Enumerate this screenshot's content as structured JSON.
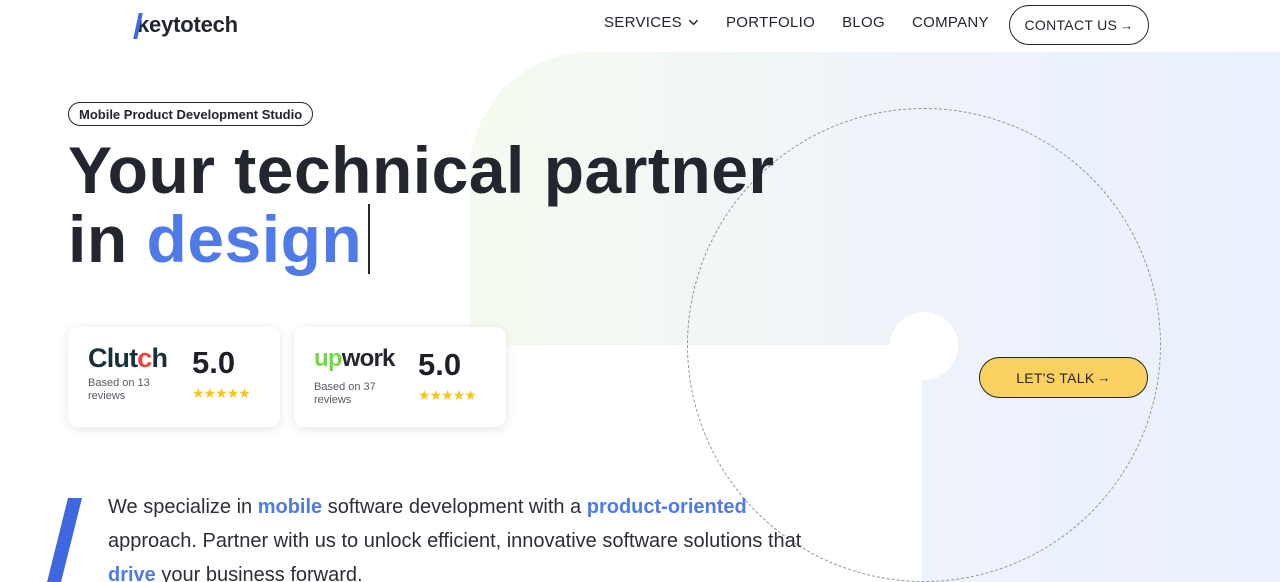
{
  "brand": {
    "logo_text": "keytotech"
  },
  "nav": {
    "services": "SERVICES",
    "portfolio": "PORTFOLIO",
    "blog": "BLOG",
    "company": "COMPANY",
    "contact": "CONTACT US"
  },
  "hero": {
    "badge": "Mobile Product Development Studio",
    "line1": "Your technical partner",
    "line2_prefix": "in ",
    "line2_accent": "design"
  },
  "reviews": [
    {
      "platform": "Clutch",
      "score": "5.0",
      "sub": "Based on 13 reviews",
      "stars": 5
    },
    {
      "platform": "upwork",
      "score": "5.0",
      "sub": "Based on 37 reviews",
      "stars": 5
    }
  ],
  "cta": {
    "talk": "LET'S TALK"
  },
  "description": {
    "p1": "We specialize in ",
    "hl1": "mobile",
    "p2": " software development with a ",
    "hl2": "product-oriented",
    "p3": " approach. Partner with us to unlock efficient, innovative software solutions that ",
    "hl3": "drive",
    "p4": " your business forward."
  },
  "colors": {
    "accent": "#4f7be8",
    "brand_blue": "#3f67e0",
    "cta_yellow": "#fbd262",
    "star": "#f5c518",
    "text_dark": "#23252f"
  },
  "icons": [
    "chevron-down-icon",
    "arrow-right-icon",
    "star-icon",
    "clutch-logo",
    "upwork-logo"
  ]
}
